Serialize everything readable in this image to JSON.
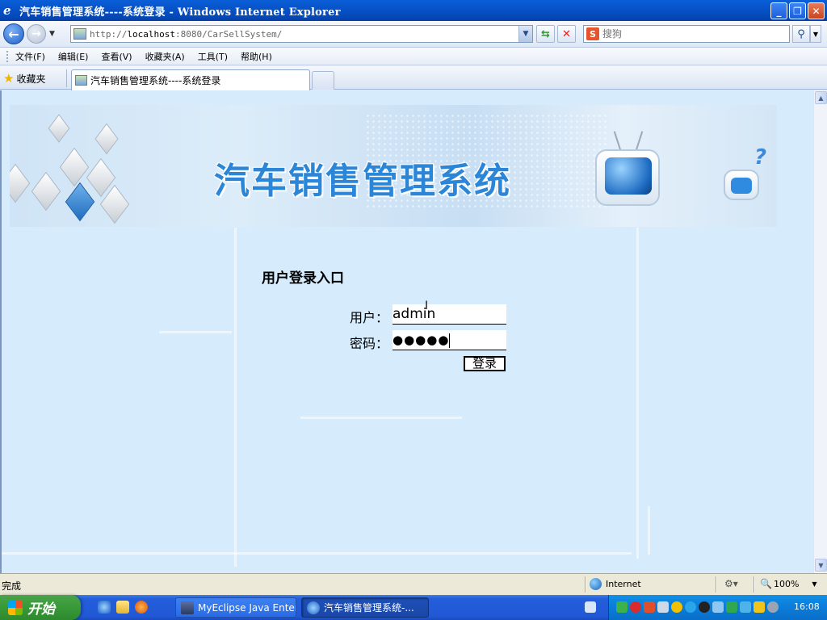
{
  "window": {
    "title": "汽车销售管理系统----系统登录 - Windows Internet Explorer"
  },
  "address_bar": {
    "url_prefix": "http://",
    "url_host": "localhost",
    "url_rest": ":8080/CarSellSystem/"
  },
  "search": {
    "placeholder": "搜狗",
    "engine_icon": "sogou-icon"
  },
  "menu": {
    "items": [
      "文件(F)",
      "编辑(E)",
      "查看(V)",
      "收藏夹(A)",
      "工具(T)",
      "帮助(H)"
    ]
  },
  "favorites": {
    "label": "收藏夹"
  },
  "tabs": {
    "active_label": "汽车销售管理系统----系统登录"
  },
  "banner": {
    "title": "汽车销售管理系统"
  },
  "login": {
    "heading": "用户登录入口",
    "username_label": "用户：",
    "username_value": "admin",
    "password_label": "密码：",
    "password_mask": "●●●●●",
    "submit_label": "登录"
  },
  "status_bar": {
    "status": "完成",
    "zone": "Internet",
    "zoom": "100%"
  },
  "taskbar": {
    "start_label": "开始",
    "tasks": [
      {
        "label": "MyEclipse Java Enter...",
        "active": false
      },
      {
        "label": "汽车销售管理系统-...",
        "active": true
      }
    ],
    "clock": "16:08"
  },
  "colors": {
    "content_background": "#d6ecfd",
    "banner_title": "#2c86d8",
    "titlebar": "#0753c9",
    "taskbar": "#245edb",
    "start_button": "#3a9c3a"
  }
}
